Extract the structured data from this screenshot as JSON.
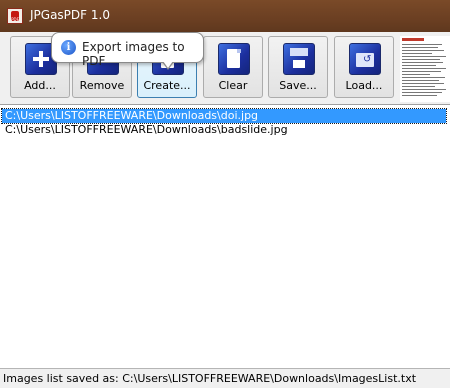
{
  "window": {
    "title": "JPGasPDF 1.0"
  },
  "toolbar": {
    "buttons": [
      {
        "label": "Add...",
        "icon": "plus-icon"
      },
      {
        "label": "Remove",
        "icon": "minus-icon"
      },
      {
        "label": "Create...",
        "icon": "create-pdf-icon"
      },
      {
        "label": "Clear",
        "icon": "clear-document-icon"
      },
      {
        "label": "Save...",
        "icon": "floppy-disk-icon"
      },
      {
        "label": "Load...",
        "icon": "open-folder-icon"
      }
    ]
  },
  "tooltip": {
    "text": "Export images to PDF",
    "icon": "info-icon"
  },
  "files": [
    {
      "path": "C:\\Users\\LISTOFFREEWARE\\Downloads\\doi.jpg",
      "selected": true
    },
    {
      "path": "C:\\Users\\LISTOFFREEWARE\\Downloads\\badslide.jpg",
      "selected": false
    }
  ],
  "status": {
    "text": "Images list saved as: C:\\Users\\LISTOFFREEWARE\\Downloads\\ImagesList.txt"
  },
  "colors": {
    "titlebar": "#6b3f22",
    "selection": "#3399ff",
    "icon_blue": "#1c2f9e"
  }
}
